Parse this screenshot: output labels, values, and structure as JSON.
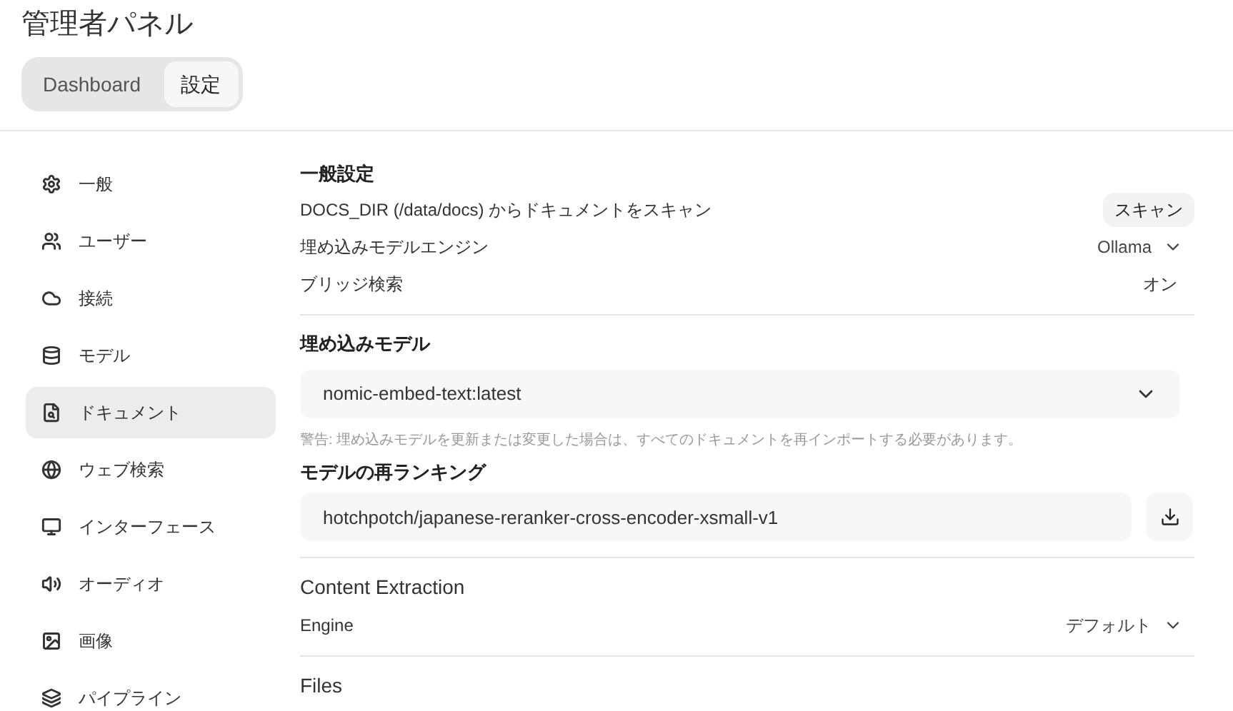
{
  "title": "管理者パネル",
  "tabs": [
    {
      "label": "Dashboard",
      "selected": false
    },
    {
      "label": "設定",
      "selected": true
    }
  ],
  "sidebar": {
    "items": [
      {
        "label": "一般",
        "selected": false
      },
      {
        "label": "ユーザー",
        "selected": false
      },
      {
        "label": "接続",
        "selected": false
      },
      {
        "label": "モデル",
        "selected": false
      },
      {
        "label": "ドキュメント",
        "selected": true
      },
      {
        "label": "ウェブ検索",
        "selected": false
      },
      {
        "label": "インターフェース",
        "selected": false
      },
      {
        "label": "オーディオ",
        "selected": false
      },
      {
        "label": "画像",
        "selected": false
      },
      {
        "label": "パイプライン",
        "selected": false
      }
    ]
  },
  "general": {
    "heading": "一般設定",
    "rows": [
      {
        "kind": "button",
        "label": "DOCS_DIR (/data/docs) からドキュメントをスキャン",
        "value": "スキャン"
      },
      {
        "kind": "dropdown",
        "label": "埋め込みモデルエンジン",
        "value": "Ollama"
      },
      {
        "kind": "value",
        "label": "ブリッジ検索",
        "value": "オン"
      }
    ]
  },
  "embedding": {
    "heading": "埋め込みモデル",
    "select": "nomic-embed-text:latest",
    "warning": "警告: 埋め込みモデルを更新または変更した場合は、すべてのドキュメントを再インポートする必要があります。"
  },
  "reranking": {
    "heading": "モデルの再ランキング",
    "value": "hotchpotch/japanese-reranker-cross-encoder-xsmall-v1"
  },
  "content_extraction": {
    "heading": "Content Extraction",
    "rows": [
      {
        "kind": "dropdown",
        "label": "Engine",
        "value": "デフォルト"
      }
    ]
  },
  "files": {
    "heading": "Files"
  }
}
